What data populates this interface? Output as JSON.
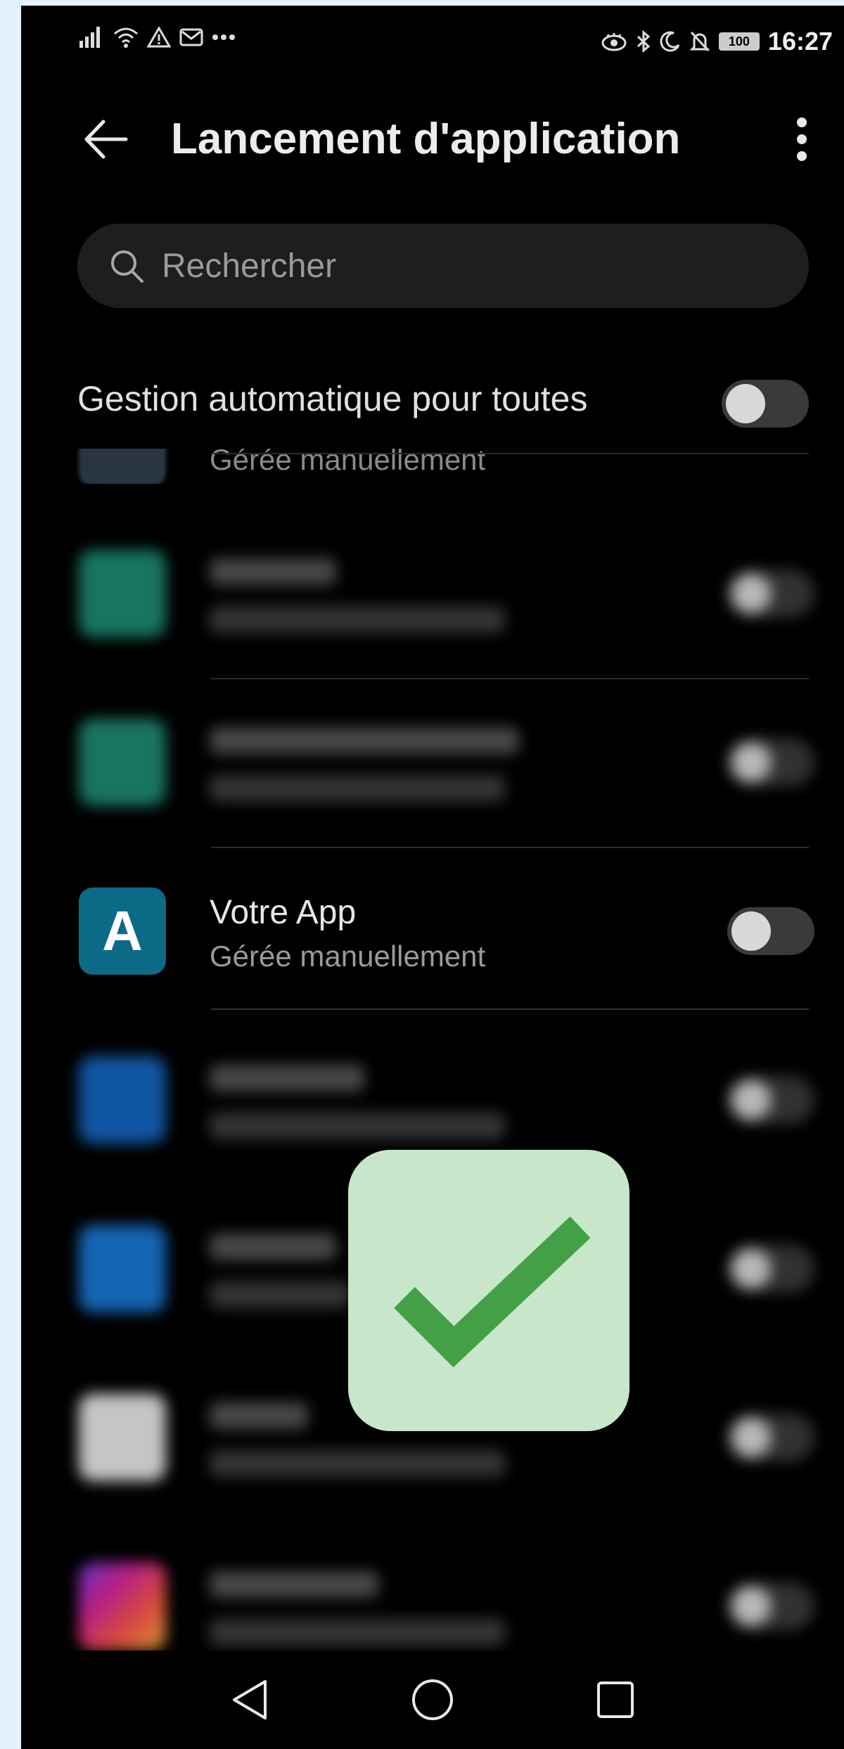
{
  "status_bar": {
    "left_icons": [
      "signal-icon",
      "wifi-icon",
      "warning-icon",
      "mail-icon",
      "more-dots-icon"
    ],
    "right_icons": [
      "eye-icon",
      "bluetooth-icon",
      "moon-icon",
      "bell-off-icon"
    ],
    "battery": "100",
    "time": "16:27"
  },
  "header": {
    "title": "Lancement d'application",
    "back_icon": "arrow-left-icon",
    "more_icon": "more-vertical-icon"
  },
  "search": {
    "placeholder": "Rechercher",
    "value": ""
  },
  "auto_manage": {
    "label": "Gestion automatique pour toutes",
    "enabled": false
  },
  "apps": [
    {
      "name": "Votre App",
      "status": "Gérée manuellement",
      "icon_letter": "A",
      "icon_color": "#0d6a86",
      "enabled": false
    }
  ],
  "partial_row": {
    "status": "Gérée manuellement"
  },
  "overlay": {
    "icon": "checkmark-icon",
    "bg_color": "#c8e6c9",
    "check_color": "#43a047"
  },
  "nav_bar": {
    "items": [
      "back-triangle-icon",
      "home-circle-icon",
      "recents-square-icon"
    ]
  }
}
